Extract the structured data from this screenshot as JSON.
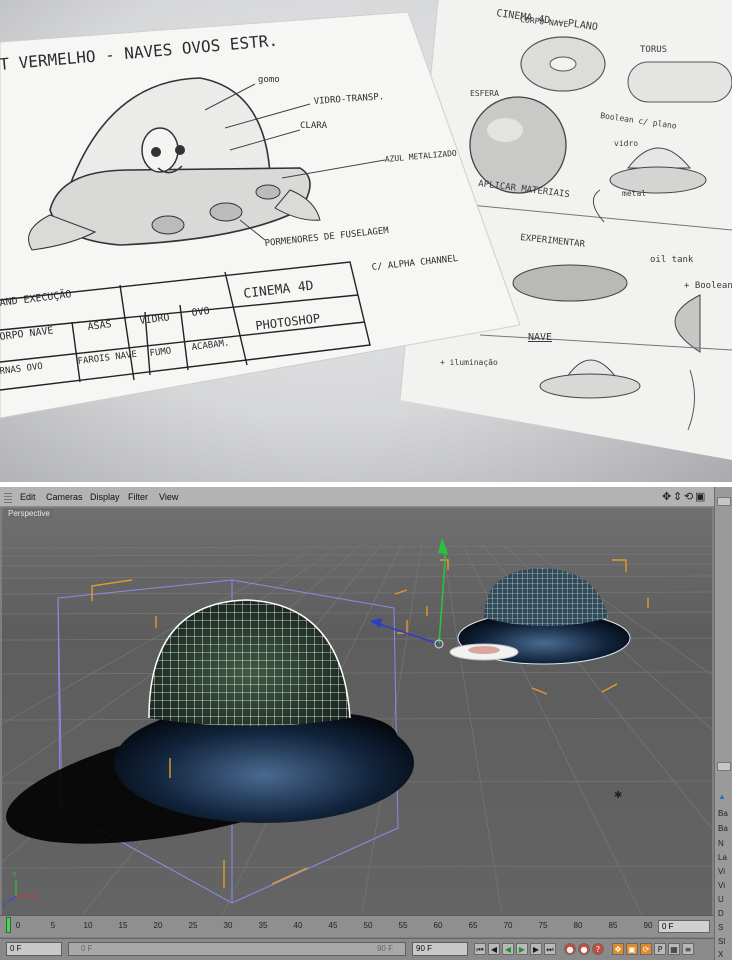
{
  "sketch_left": {
    "title": "T VERMELHO - NAVES OVOS ESTR.",
    "annotations": {
      "label_1": "gomo",
      "label_2": "VIDRO-TRANSP.",
      "label_3": "CLARA",
      "label_4": "AZUL METALIZADO",
      "label_5": "PORMENORES DE FUSELAGEM",
      "label_6": "C/ ALPHA CHANNEL"
    },
    "table_cells": [
      "AND EXECUÇÃO",
      "CINEMA 4D",
      "ORPO NAVE",
      "ASAS",
      "VIDRO",
      "OVO",
      "PHOTOSHOP",
      "RNAS OVO",
      "FAROIS NAVE",
      "FUMO",
      "ACABAM."
    ]
  },
  "sketch_right": {
    "title": "CINEMA 4D — PLANO",
    "annotations": {
      "label_1": "CORPO NAVE",
      "label_2": "TORUS",
      "label_3": "ESFERA",
      "label_4": "Boolean c/ plano",
      "label_5": "vidro",
      "label_6": "metal",
      "label_7": "APLICAR MATERIAIS",
      "label_8": "EXPERIMENTAR",
      "label_9": "oil tank",
      "label_10": "+ Boolean",
      "label_11": "NAVE",
      "label_12": "+ iluminação"
    }
  },
  "app": {
    "menu": {
      "edit": "Edit",
      "cameras": "Cameras",
      "display": "Display",
      "filter": "Filter",
      "view": "View"
    },
    "viewport": {
      "label": "Perspective"
    },
    "timeline": {
      "ticks": [
        "0",
        "5",
        "10",
        "15",
        "20",
        "25",
        "30",
        "35",
        "40",
        "45",
        "50",
        "55",
        "60",
        "65",
        "70",
        "75",
        "80",
        "85",
        "90"
      ],
      "end_field": "0 F",
      "current_frame": 0
    },
    "controls": {
      "start_field": "0 F",
      "range_start": "0 F",
      "range_end": "90 F",
      "end_field": "90 F"
    },
    "right_panel": [
      "Ba",
      "Ba",
      "N",
      "La",
      "Vi",
      "Vi",
      "U",
      "D",
      "S",
      "Sl",
      "X"
    ]
  }
}
